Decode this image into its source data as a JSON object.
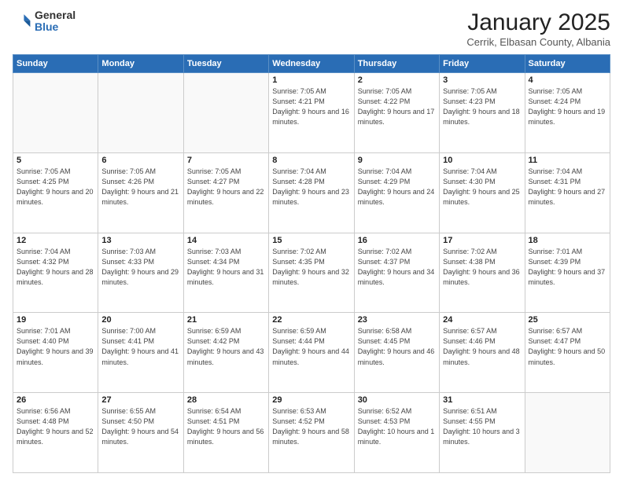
{
  "header": {
    "logo_general": "General",
    "logo_blue": "Blue",
    "month": "January 2025",
    "location": "Cerrik, Elbasan County, Albania"
  },
  "calendar": {
    "days_of_week": [
      "Sunday",
      "Monday",
      "Tuesday",
      "Wednesday",
      "Thursday",
      "Friday",
      "Saturday"
    ],
    "weeks": [
      [
        {
          "day": "",
          "info": ""
        },
        {
          "day": "",
          "info": ""
        },
        {
          "day": "",
          "info": ""
        },
        {
          "day": "1",
          "info": "Sunrise: 7:05 AM\nSunset: 4:21 PM\nDaylight: 9 hours and 16 minutes."
        },
        {
          "day": "2",
          "info": "Sunrise: 7:05 AM\nSunset: 4:22 PM\nDaylight: 9 hours and 17 minutes."
        },
        {
          "day": "3",
          "info": "Sunrise: 7:05 AM\nSunset: 4:23 PM\nDaylight: 9 hours and 18 minutes."
        },
        {
          "day": "4",
          "info": "Sunrise: 7:05 AM\nSunset: 4:24 PM\nDaylight: 9 hours and 19 minutes."
        }
      ],
      [
        {
          "day": "5",
          "info": "Sunrise: 7:05 AM\nSunset: 4:25 PM\nDaylight: 9 hours and 20 minutes."
        },
        {
          "day": "6",
          "info": "Sunrise: 7:05 AM\nSunset: 4:26 PM\nDaylight: 9 hours and 21 minutes."
        },
        {
          "day": "7",
          "info": "Sunrise: 7:05 AM\nSunset: 4:27 PM\nDaylight: 9 hours and 22 minutes."
        },
        {
          "day": "8",
          "info": "Sunrise: 7:04 AM\nSunset: 4:28 PM\nDaylight: 9 hours and 23 minutes."
        },
        {
          "day": "9",
          "info": "Sunrise: 7:04 AM\nSunset: 4:29 PM\nDaylight: 9 hours and 24 minutes."
        },
        {
          "day": "10",
          "info": "Sunrise: 7:04 AM\nSunset: 4:30 PM\nDaylight: 9 hours and 25 minutes."
        },
        {
          "day": "11",
          "info": "Sunrise: 7:04 AM\nSunset: 4:31 PM\nDaylight: 9 hours and 27 minutes."
        }
      ],
      [
        {
          "day": "12",
          "info": "Sunrise: 7:04 AM\nSunset: 4:32 PM\nDaylight: 9 hours and 28 minutes."
        },
        {
          "day": "13",
          "info": "Sunrise: 7:03 AM\nSunset: 4:33 PM\nDaylight: 9 hours and 29 minutes."
        },
        {
          "day": "14",
          "info": "Sunrise: 7:03 AM\nSunset: 4:34 PM\nDaylight: 9 hours and 31 minutes."
        },
        {
          "day": "15",
          "info": "Sunrise: 7:02 AM\nSunset: 4:35 PM\nDaylight: 9 hours and 32 minutes."
        },
        {
          "day": "16",
          "info": "Sunrise: 7:02 AM\nSunset: 4:37 PM\nDaylight: 9 hours and 34 minutes."
        },
        {
          "day": "17",
          "info": "Sunrise: 7:02 AM\nSunset: 4:38 PM\nDaylight: 9 hours and 36 minutes."
        },
        {
          "day": "18",
          "info": "Sunrise: 7:01 AM\nSunset: 4:39 PM\nDaylight: 9 hours and 37 minutes."
        }
      ],
      [
        {
          "day": "19",
          "info": "Sunrise: 7:01 AM\nSunset: 4:40 PM\nDaylight: 9 hours and 39 minutes."
        },
        {
          "day": "20",
          "info": "Sunrise: 7:00 AM\nSunset: 4:41 PM\nDaylight: 9 hours and 41 minutes."
        },
        {
          "day": "21",
          "info": "Sunrise: 6:59 AM\nSunset: 4:42 PM\nDaylight: 9 hours and 43 minutes."
        },
        {
          "day": "22",
          "info": "Sunrise: 6:59 AM\nSunset: 4:44 PM\nDaylight: 9 hours and 44 minutes."
        },
        {
          "day": "23",
          "info": "Sunrise: 6:58 AM\nSunset: 4:45 PM\nDaylight: 9 hours and 46 minutes."
        },
        {
          "day": "24",
          "info": "Sunrise: 6:57 AM\nSunset: 4:46 PM\nDaylight: 9 hours and 48 minutes."
        },
        {
          "day": "25",
          "info": "Sunrise: 6:57 AM\nSunset: 4:47 PM\nDaylight: 9 hours and 50 minutes."
        }
      ],
      [
        {
          "day": "26",
          "info": "Sunrise: 6:56 AM\nSunset: 4:48 PM\nDaylight: 9 hours and 52 minutes."
        },
        {
          "day": "27",
          "info": "Sunrise: 6:55 AM\nSunset: 4:50 PM\nDaylight: 9 hours and 54 minutes."
        },
        {
          "day": "28",
          "info": "Sunrise: 6:54 AM\nSunset: 4:51 PM\nDaylight: 9 hours and 56 minutes."
        },
        {
          "day": "29",
          "info": "Sunrise: 6:53 AM\nSunset: 4:52 PM\nDaylight: 9 hours and 58 minutes."
        },
        {
          "day": "30",
          "info": "Sunrise: 6:52 AM\nSunset: 4:53 PM\nDaylight: 10 hours and 1 minute."
        },
        {
          "day": "31",
          "info": "Sunrise: 6:51 AM\nSunset: 4:55 PM\nDaylight: 10 hours and 3 minutes."
        },
        {
          "day": "",
          "info": ""
        }
      ]
    ]
  }
}
